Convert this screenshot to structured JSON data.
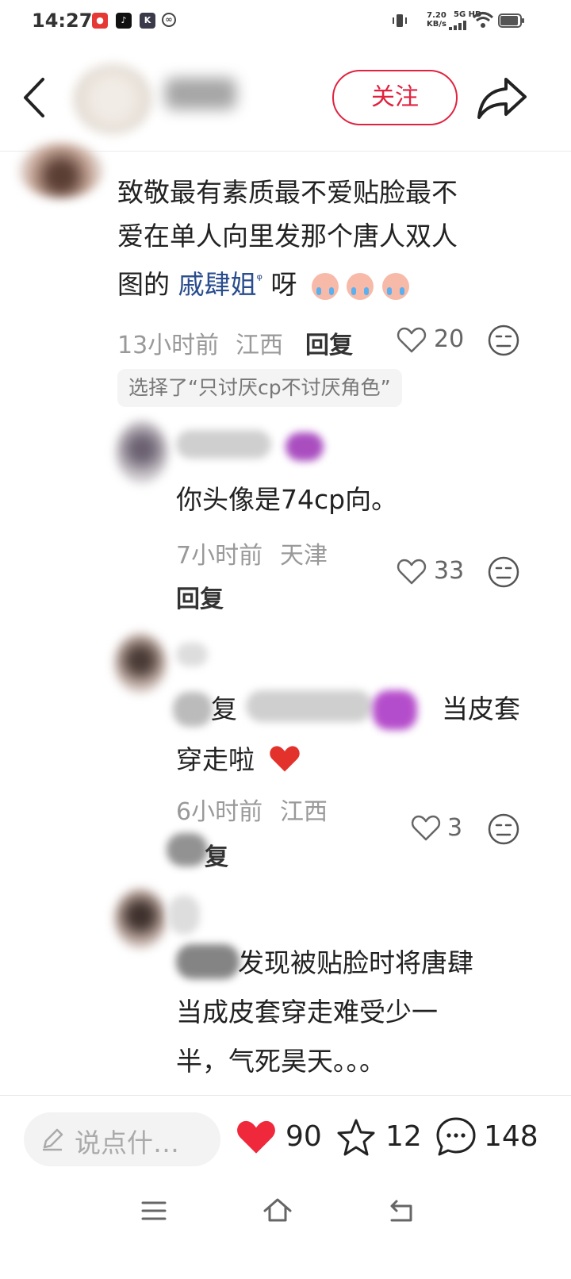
{
  "status_bar": {
    "time": "14:27",
    "net_speed_value": "7.20",
    "net_speed_unit": "KB/s",
    "signal_label": "5G HD"
  },
  "header": {
    "back_icon": "chevron-left-icon",
    "follow_label": "关注",
    "share_icon": "share-arrow-icon"
  },
  "comments": [
    {
      "text_lines": [
        "致敬最有素质最不爱贴脸最不",
        "爱在单人向里发那个唐人双人"
      ],
      "line3_prefix": "图的 ",
      "mention": "戚肆姐",
      "mention_mark": "ᵠ",
      "line3_suffix": " 呀",
      "time": "13小时前",
      "location": "江西",
      "reply_label": "回复",
      "likes": "20",
      "tag": "选择了“只讨厌cp不讨厌角色”"
    },
    {
      "text": "你头像是74cp向。",
      "time": "7小时前",
      "location": "天津",
      "reply_label": "回复",
      "likes": "33"
    },
    {
      "line1_suffix": "当皮套",
      "line2": "穿走啦",
      "reply_fragment": "复",
      "time": "6小时前",
      "location": "江西",
      "reply_fragment2": "复",
      "likes": "3"
    },
    {
      "line1": "发现被贴脸时将唐肆",
      "line2": "当成皮套穿走难受少一",
      "line3": "半，气死昊天。。。"
    }
  ],
  "bottom_bar": {
    "input_placeholder": "说点什…",
    "like_count": "90",
    "favorite_count": "12",
    "comment_count": "148"
  },
  "colors": {
    "accent_red": "#e0223f",
    "mention_blue": "#2a4d8f",
    "meta_gray": "#999999"
  }
}
